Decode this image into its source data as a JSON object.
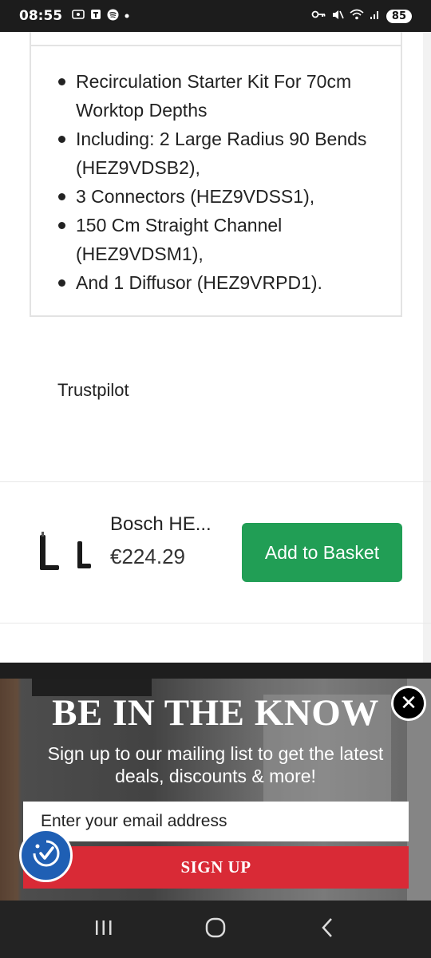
{
  "status_bar": {
    "time": "08:55",
    "battery": "85",
    "left_icons": [
      "screen-record-icon",
      "teams-icon",
      "spotify-icon",
      "dot-icon"
    ],
    "right_icons": [
      "vpn-key-icon",
      "mute-icon",
      "wifi-icon",
      "signal-icon"
    ]
  },
  "description": {
    "features": [
      "Recirculation Starter Kit For 70cm Worktop Depths",
      "Including: 2 Large Radius 90 Bends (HEZ9VDSB2),",
      "3 Connectors (HEZ9VDSS1),",
      "150 Cm Straight Channel (HEZ9VDSM1),",
      "And 1 Diffusor (HEZ9VRPD1)."
    ]
  },
  "trustpilot": {
    "label": "Trustpilot"
  },
  "product_bar": {
    "name": "Bosch HE...",
    "price": "€224.29",
    "add_label": "Add to Basket",
    "button_color": "#219e55"
  },
  "popup": {
    "heading": "BE IN THE KNOW",
    "subtitle": "Sign up to our mailing list to get the latest deals, discounts & more!",
    "email_placeholder": "Enter your email address",
    "signup_label": "SIGN UP",
    "signup_color": "#d92a36"
  },
  "nav": {
    "icons": [
      "recent-apps-icon",
      "home-icon",
      "back-icon"
    ]
  }
}
